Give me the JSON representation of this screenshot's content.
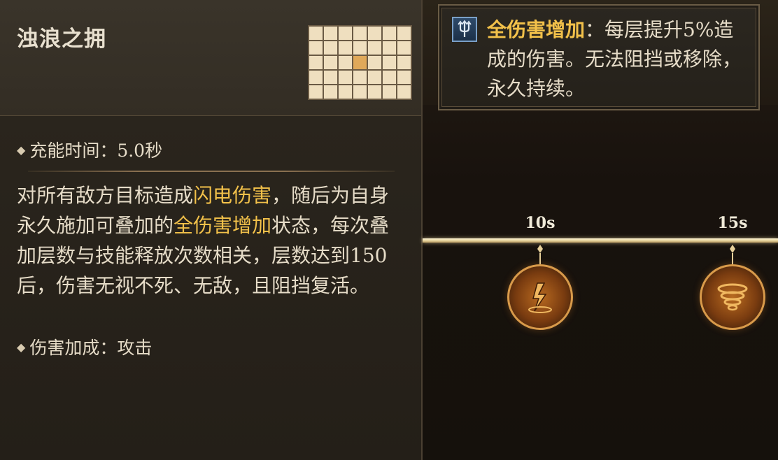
{
  "skill": {
    "title": "浊浪之拥",
    "range_grid": {
      "cols": 7,
      "rows": 5,
      "highlight": [
        2,
        3
      ]
    },
    "cooldown": "充能时间：5.0秒",
    "description": [
      {
        "text": "对所有敌方目标造成",
        "hl": false
      },
      {
        "text": "闪电伤害",
        "hl": true
      },
      {
        "text": "，随后为自身永久施加可叠加的",
        "hl": false
      },
      {
        "text": "全伤害增加",
        "hl": true
      },
      {
        "text": "状态，每次叠加层数与技能释放次数相关，层数达到150后，伤害无视不死、无敌，且阻挡复活。",
        "hl": false
      }
    ],
    "damage_bonus": "伤害加成：攻击",
    "diamond_icon": "◆"
  },
  "tooltip": {
    "buff_name": "全伤害增加",
    "buff_text": "：每层提升5%造成的伤害。无法阻挡或移除，永久持续。",
    "icon": "trident-icon"
  },
  "timeline": {
    "ticks": [
      "10s",
      "15s"
    ]
  },
  "colors": {
    "highlight": "#f2c14a",
    "text": "#e6dcc8",
    "grid_on": "#e0a95a",
    "grid_off": "#efdfbf"
  }
}
